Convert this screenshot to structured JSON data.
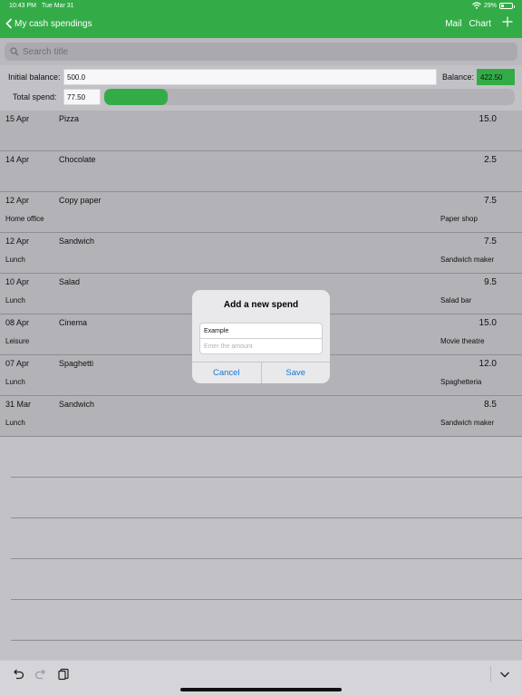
{
  "status": {
    "time": "10:43 PM",
    "date": "Tue Mar 31",
    "battery": "29%",
    "battery_level": 0.29
  },
  "nav": {
    "back_label": "My cash spendings",
    "mail_label": "Mail",
    "chart_label": "Chart",
    "add_icon": "plus-icon"
  },
  "search": {
    "placeholder": "Search title"
  },
  "balance": {
    "initial_label": "Initial balance:",
    "initial_value": "500.0",
    "balance_label": "Balance:",
    "balance_value": "422.50",
    "total_label": "Total spend:",
    "total_value": "77.50",
    "progress_fraction": 0.155
  },
  "spends": [
    {
      "date": "15 Apr",
      "title": "Pizza",
      "amount": "15.0",
      "category": "",
      "shop": ""
    },
    {
      "date": "14 Apr",
      "title": "Chocolate",
      "amount": "2.5",
      "category": "",
      "shop": ""
    },
    {
      "date": "12 Apr",
      "title": "Copy paper",
      "amount": "7.5",
      "category": "Home office",
      "shop": "Paper shop"
    },
    {
      "date": "12 Apr",
      "title": "Sandwich",
      "amount": "7.5",
      "category": "Lunch",
      "shop": "Sandwich maker"
    },
    {
      "date": "10 Apr",
      "title": "Salad",
      "amount": "9.5",
      "category": "Lunch",
      "shop": "Salad bar"
    },
    {
      "date": "08 Apr",
      "title": "Cinema",
      "amount": "15.0",
      "category": "Leisure",
      "shop": "Movie theatre"
    },
    {
      "date": "07 Apr",
      "title": "Spaghetti",
      "amount": "12.0",
      "category": "Lunch",
      "shop": "Spaghetteria"
    },
    {
      "date": "31 Mar",
      "title": "Sandwich",
      "amount": "8.5",
      "category": "Lunch",
      "shop": "Sandwich maker"
    }
  ],
  "dialog": {
    "title": "Add a new spend",
    "title_value": "Example",
    "amount_placeholder": "Enter the amount",
    "cancel_label": "Cancel",
    "save_label": "Save"
  },
  "colors": {
    "accent": "#33ac48",
    "link": "#1476d6"
  }
}
